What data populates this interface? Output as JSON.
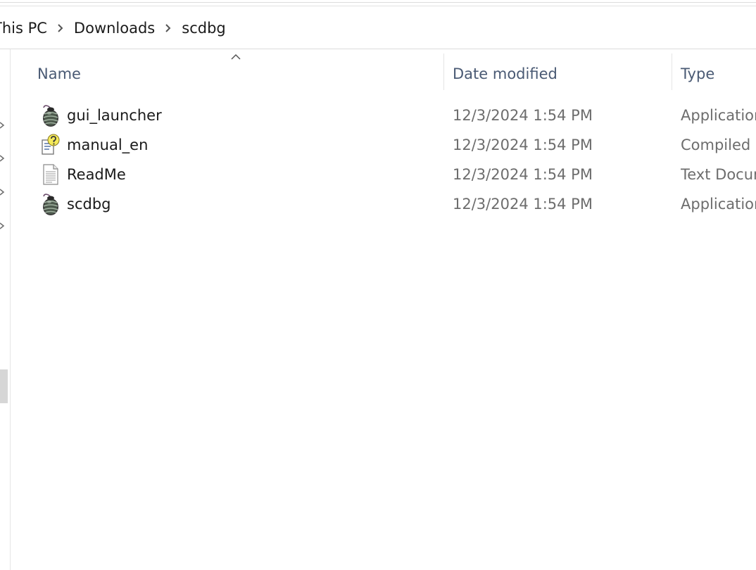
{
  "breadcrumb": {
    "items": [
      "This PC",
      "Downloads",
      "scdbg"
    ]
  },
  "columns": {
    "name": "Name",
    "date_modified": "Date modified",
    "type": "Type",
    "sorted_by": "name",
    "sort_direction": "ascending"
  },
  "files": [
    {
      "name": "gui_launcher",
      "date": "12/3/2024 1:54 PM",
      "type": "Application",
      "icon": "bug-app-icon"
    },
    {
      "name": "manual_en",
      "date": "12/3/2024 1:54 PM",
      "type": "Compiled HTML Help file",
      "icon": "help-file-icon"
    },
    {
      "name": "ReadMe",
      "date": "12/3/2024 1:54 PM",
      "type": "Text Document",
      "icon": "text-document-icon"
    },
    {
      "name": "scdbg",
      "date": "12/3/2024 1:54 PM",
      "type": "Application",
      "icon": "bug-app-icon"
    }
  ],
  "colors": {
    "header_text": "#4a5a74",
    "secondary_text": "#6d6d6d",
    "primary_text": "#1a1a1a",
    "divider": "#e5e5e5"
  }
}
